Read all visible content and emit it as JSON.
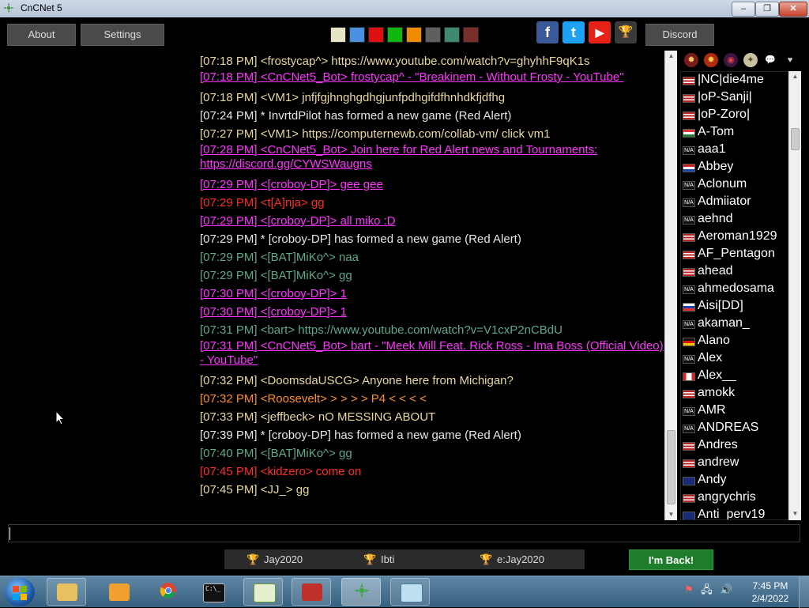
{
  "window": {
    "title": "CnCNet 5",
    "min_label": "–",
    "max_label": "❐",
    "close_label": "✕"
  },
  "topbar": {
    "about_label": "About",
    "settings_label": "Settings",
    "discord_label": "Discord",
    "swatches": [
      "#e6e3c4",
      "#4a90e2",
      "#e01010",
      "#0fb80f",
      "#f08a00",
      "#5f5f5f",
      "#3e8a6e",
      "#7a2e2a"
    ],
    "social": {
      "facebook": "f",
      "twitter": "t",
      "youtube": "▶",
      "trophy": "🏆"
    }
  },
  "chat": {
    "messages": [
      {
        "text": "[07:18 PM] <frostycap^> https://www.youtube.com/watch?v=ghyhhF9qK1s",
        "color": "#e8d8a0",
        "link": false
      },
      {
        "text": "[07:18 PM] <CnCNet5_Bot> frostycap^ - \"Breakinem - Without Frosty - YouTube\"",
        "color": "#ff33ff",
        "link": true,
        "wrap": true
      },
      {
        "text": "[07:18 PM] <VM1> jnfjfgjhnghgdhgjunfpdhgifdfhnhdkfjdfhg",
        "color": "#e8d8a0",
        "link": false
      },
      {
        "text": "[07:24 PM] * InvrtdPilot has formed a new game (Red Alert)",
        "color": "#e6e6e6",
        "link": false
      },
      {
        "text": "[07:27 PM] <VM1> https://computernewb.com/collab-vm/ click vm1",
        "color": "#e8d8a0",
        "link": false
      },
      {
        "text": "[07:28 PM] <CnCNet5_Bot> Join here for Red Alert news and Tournaments: https://discord.gg/CYWSWaugns",
        "color": "#ff33ff",
        "link": true,
        "wrap": true
      },
      {
        "text": "[07:29 PM] <[croboy-DP]> gee gee",
        "color": "#ff33ff",
        "link": true
      },
      {
        "text": "[07:29 PM] <t[A]nja> gg",
        "color": "#ff2a2a",
        "link": false
      },
      {
        "text": "[07:29 PM] <[croboy-DP]> all miko :D",
        "color": "#ff33ff",
        "link": true
      },
      {
        "text": "[07:29 PM] * [croboy-DP] has formed a new game (Red Alert)",
        "color": "#e6e6e6",
        "link": false
      },
      {
        "text": "[07:29 PM] <[BAT]MiKo^> naa",
        "color": "#5fa88a",
        "link": false
      },
      {
        "text": "[07:29 PM] <[BAT]MiKo^> gg",
        "color": "#5fa88a",
        "link": false
      },
      {
        "text": "[07:30 PM] <[croboy-DP]> 1",
        "color": "#ff33ff",
        "link": true
      },
      {
        "text": "[07:30 PM] <[croboy-DP]> 1",
        "color": "#ff33ff",
        "link": true
      },
      {
        "text": "[07:31 PM] <bart> https://www.youtube.com/watch?v=V1cxP2nCBdU",
        "color": "#5fa88a",
        "link": false
      },
      {
        "text": "[07:31 PM] <CnCNet5_Bot> bart - \"Meek Mill Feat. Rick Ross - Ima Boss (Official Video) - YouTube\"",
        "color": "#ff33ff",
        "link": true,
        "wrap": true
      },
      {
        "text": "[07:32 PM] <DoomsdaUSCG> Anyone here from Michigan?",
        "color": "#e8d8a0",
        "link": false
      },
      {
        "text": "[07:32 PM] <Roosevelt> > > > > P4 < < < <",
        "color": "#ff8c2a",
        "link": false
      },
      {
        "text": "[07:33 PM] <jeffbeck> nO MESSING ABOUT",
        "color": "#e8d8a0",
        "link": false
      },
      {
        "text": "[07:39 PM] * [croboy-DP] has formed a new game (Red Alert)",
        "color": "#e6e6e6",
        "link": false
      },
      {
        "text": "[07:40 PM] <[BAT]MiKo^> gg",
        "color": "#5fa88a",
        "link": false
      },
      {
        "text": "[07:45 PM] <kidzero> come on",
        "color": "#ff2a2a",
        "link": false
      },
      {
        "text": "[07:45 PM] <JJ_> gg",
        "color": "#e8d8a0",
        "link": false
      }
    ]
  },
  "game_icons": [
    "ra-icon",
    "ts-icon",
    "yr-icon",
    "d2-icon",
    "chat-icon",
    "heart-icon"
  ],
  "users": [
    {
      "name": "|NC|die4me",
      "flag": "us"
    },
    {
      "name": "|oP-Sanji|",
      "flag": "us"
    },
    {
      "name": "|oP-Zoro|",
      "flag": "us"
    },
    {
      "name": "A-Tom",
      "flag": "hu"
    },
    {
      "name": "aaa1",
      "flag": "na"
    },
    {
      "name": "Abbey",
      "flag": "nl"
    },
    {
      "name": "Aclonum",
      "flag": "na"
    },
    {
      "name": "Admiiator",
      "flag": "na"
    },
    {
      "name": "aehnd",
      "flag": "na"
    },
    {
      "name": "Aeroman1929",
      "flag": "us"
    },
    {
      "name": "AF_Pentagon",
      "flag": "us"
    },
    {
      "name": "ahead",
      "flag": "us"
    },
    {
      "name": "ahmedosama",
      "flag": "na"
    },
    {
      "name": "Aisi[DD]",
      "flag": "sk"
    },
    {
      "name": "akaman_",
      "flag": "na"
    },
    {
      "name": "Alano",
      "flag": "de"
    },
    {
      "name": "Alex",
      "flag": "na"
    },
    {
      "name": "Alex__",
      "flag": "ca"
    },
    {
      "name": "amokk",
      "flag": "us"
    },
    {
      "name": "AMR",
      "flag": "na"
    },
    {
      "name": "ANDREAS",
      "flag": "na"
    },
    {
      "name": "Andres",
      "flag": "us"
    },
    {
      "name": "andrew",
      "flag": "us"
    },
    {
      "name": "Andy",
      "flag": "au"
    },
    {
      "name": "angrychris",
      "flag": "us"
    },
    {
      "name": "Anti_perv19",
      "flag": "gb"
    }
  ],
  "flag_na_label": "N/A",
  "games_bar": [
    {
      "name": "Jay2020",
      "trophy_color": "#e0b030"
    },
    {
      "name": "Ibti",
      "trophy_color": "#cccccc"
    },
    {
      "name": "e:Jay2020",
      "trophy_color": "#e08030"
    }
  ],
  "back_button": "I'm Back!",
  "taskbar": {
    "time": "7:45 PM",
    "date": "2/4/2022",
    "cmd_label": "C:\\_"
  }
}
